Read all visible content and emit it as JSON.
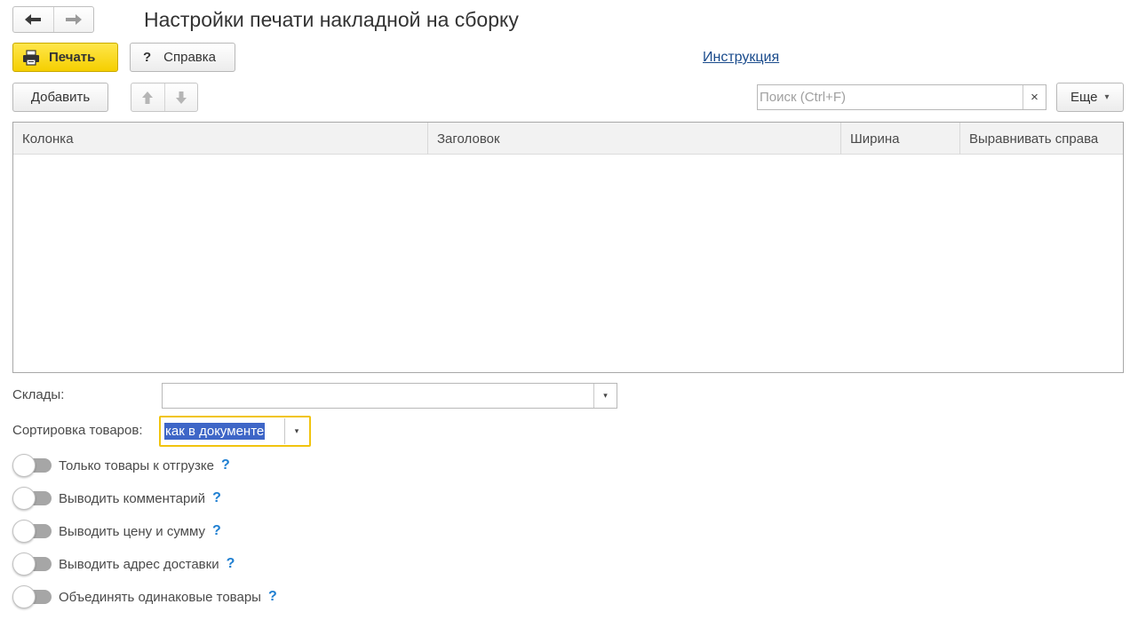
{
  "header": {
    "title": "Настройки печати накладной на сборку"
  },
  "nav": {
    "back_icon": "arrow-left-icon",
    "forward_icon": "arrow-right-icon"
  },
  "toolbar": {
    "print_label": "Печать",
    "help_label": "Справка",
    "help_glyph": "?",
    "instruction_link": "Инструкция"
  },
  "table_toolbar": {
    "add_label": "Добавить",
    "search_placeholder": "Поиск (Ctrl+F)",
    "search_clear": "×",
    "more_label": "Еще",
    "more_caret": "▾"
  },
  "table": {
    "columns": [
      "Колонка",
      "Заголовок",
      "Ширина",
      "Выравнивать справа"
    ],
    "rows": []
  },
  "form": {
    "warehouses_label": "Склады:",
    "warehouses_value": "",
    "sort_label": "Сортировка товаров:",
    "sort_value": "как в документе",
    "dropdown_glyph": "▾"
  },
  "options": [
    {
      "label": "Только товары к отгрузке",
      "enabled": false,
      "help": "?"
    },
    {
      "label": "Выводить комментарий",
      "enabled": false,
      "help": "?"
    },
    {
      "label": "Выводить цену и сумму",
      "enabled": false,
      "help": "?"
    },
    {
      "label": "Выводить адрес доставки",
      "enabled": false,
      "help": "?"
    },
    {
      "label": "Объединять одинаковые товары",
      "enabled": false,
      "help": "?"
    }
  ],
  "colors": {
    "print_button": "#f5cf00",
    "link": "#1a4b8c",
    "selection": "#3e66c7",
    "focus_border": "#f1c40f",
    "help_mark": "#1f7fd1"
  }
}
